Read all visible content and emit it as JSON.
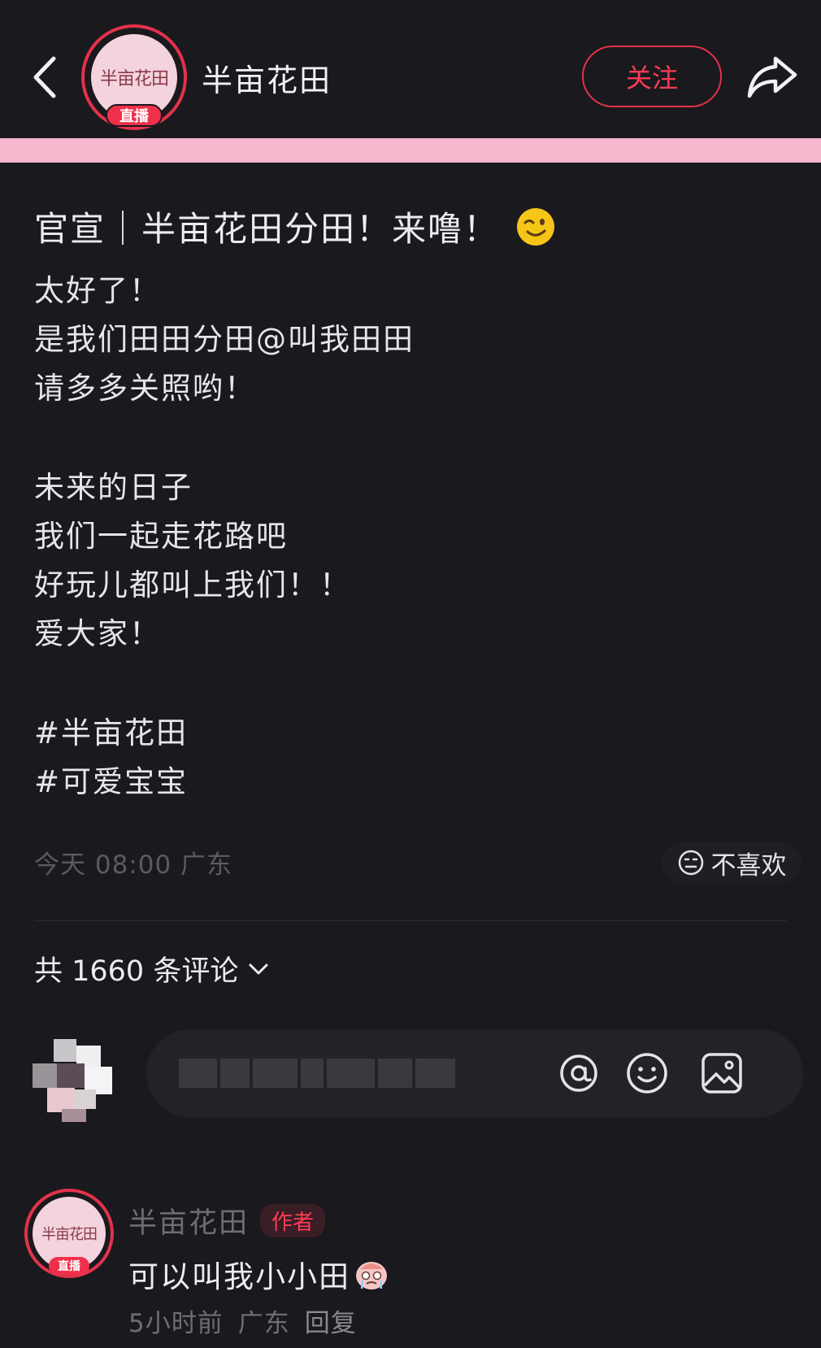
{
  "header": {
    "author_name": "半亩花田",
    "avatar_text": "半亩花田",
    "live_badge": "直播",
    "follow_label": "关注"
  },
  "post": {
    "title": "官宣｜半亩花田分田！来噜！",
    "lines": [
      "太好了！",
      "是我们田田分田@叫我田田",
      "请多多关照哟！",
      "",
      "未来的日子",
      "我们一起走花路吧",
      "好玩儿都叫上我们！！",
      "爱大家！"
    ],
    "hashtags": [
      "#半亩花田",
      "#可爱宝宝"
    ],
    "meta": "今天 08:00 广东",
    "dislike_label": "不喜欢"
  },
  "comments_section": {
    "count_label": "共 1660 条评论"
  },
  "comment": {
    "author": "半亩花田",
    "author_tag": "作者",
    "avatar_text": "半亩花田",
    "live_badge": "直播",
    "text": "可以叫我小小田",
    "time": "5小时前",
    "location": "广东",
    "reply_label": "回复"
  },
  "colors": {
    "background": "#1a191d",
    "accent_red": "#e2324b",
    "pink_bar": "#f7b7ce"
  }
}
